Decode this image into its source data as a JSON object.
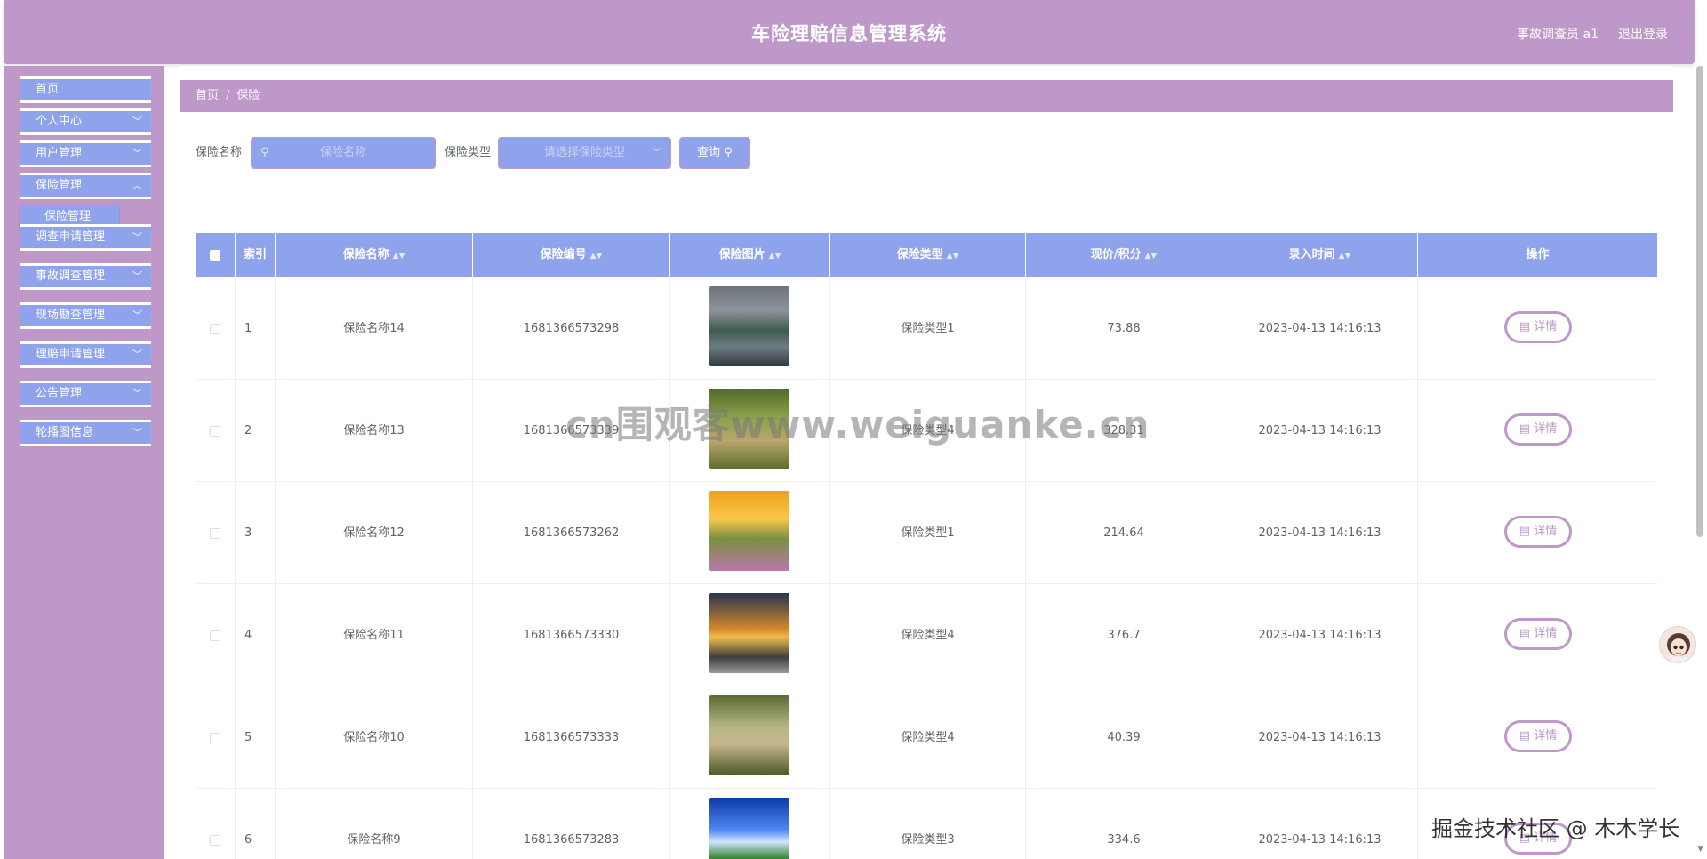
{
  "header": {
    "title": "车险理赔信息管理系统",
    "user": "事故调查员 a1",
    "logout": "退出登录"
  },
  "sidebar": {
    "items": [
      {
        "label": "首页",
        "has_children": false
      },
      {
        "label": "个人中心",
        "has_children": true
      },
      {
        "label": "用户管理",
        "has_children": true
      },
      {
        "label": "保险管理",
        "has_children": true,
        "expanded": true
      },
      {
        "label": "调查申请管理",
        "has_children": true
      },
      {
        "label": "事故调查管理",
        "has_children": true
      },
      {
        "label": "现场勘查管理",
        "has_children": true
      },
      {
        "label": "理赔申请管理",
        "has_children": true
      },
      {
        "label": "公告管理",
        "has_children": true
      },
      {
        "label": "轮播图信息",
        "has_children": true
      }
    ],
    "submenu": {
      "label": "保险管理"
    }
  },
  "breadcrumb": {
    "home": "首页",
    "separator": "/",
    "current": "保险"
  },
  "filter": {
    "name_label": "保险名称",
    "name_placeholder": "保险名称",
    "type_label": "保险类型",
    "type_placeholder": "请选择保险类型",
    "search_button": "查询"
  },
  "table": {
    "columns": [
      "索引",
      "保险名称",
      "保险编号",
      "保险图片",
      "保险类型",
      "现价/积分",
      "录入时间",
      "操作"
    ],
    "sortable": [
      false,
      true,
      true,
      true,
      true,
      true,
      true,
      false
    ],
    "detail_label": "详情",
    "rows": [
      {
        "index": "1",
        "name": "保险名称14",
        "code": "1681366573298",
        "type": "保险类型1",
        "price": "73.88",
        "time": "2023-04-13 14:16:13",
        "image": "lake-village"
      },
      {
        "index": "2",
        "name": "保险名称13",
        "code": "1681366573339",
        "type": "保险类型4",
        "price": "328.31",
        "time": "2023-04-13 14:16:13",
        "image": "forest-path"
      },
      {
        "index": "3",
        "name": "保险名称12",
        "code": "1681366573262",
        "type": "保险类型1",
        "price": "214.64",
        "time": "2023-04-13 14:16:13",
        "image": "sunset-flowers"
      },
      {
        "index": "4",
        "name": "保险名称11",
        "code": "1681366573330",
        "type": "保险类型4",
        "price": "376.7",
        "time": "2023-04-13 14:16:13",
        "image": "sunset-road"
      },
      {
        "index": "5",
        "name": "保险名称10",
        "code": "1681366573333",
        "type": "保险类型4",
        "price": "40.39",
        "time": "2023-04-13 14:16:13",
        "image": "misty-forest"
      },
      {
        "index": "6",
        "name": "保险名称9",
        "code": "1681366573283",
        "type": "保险类型3",
        "price": "334.6",
        "time": "2023-04-13 14:16:13",
        "image": "blue-sky-field"
      }
    ]
  },
  "watermarks": {
    "center": "cn围观客www.weiguanke.cn",
    "corner": "掘金技术社区 @ 木木学长"
  },
  "colors": {
    "purple": "#bf98ca",
    "blue": "#8ea3ec"
  }
}
